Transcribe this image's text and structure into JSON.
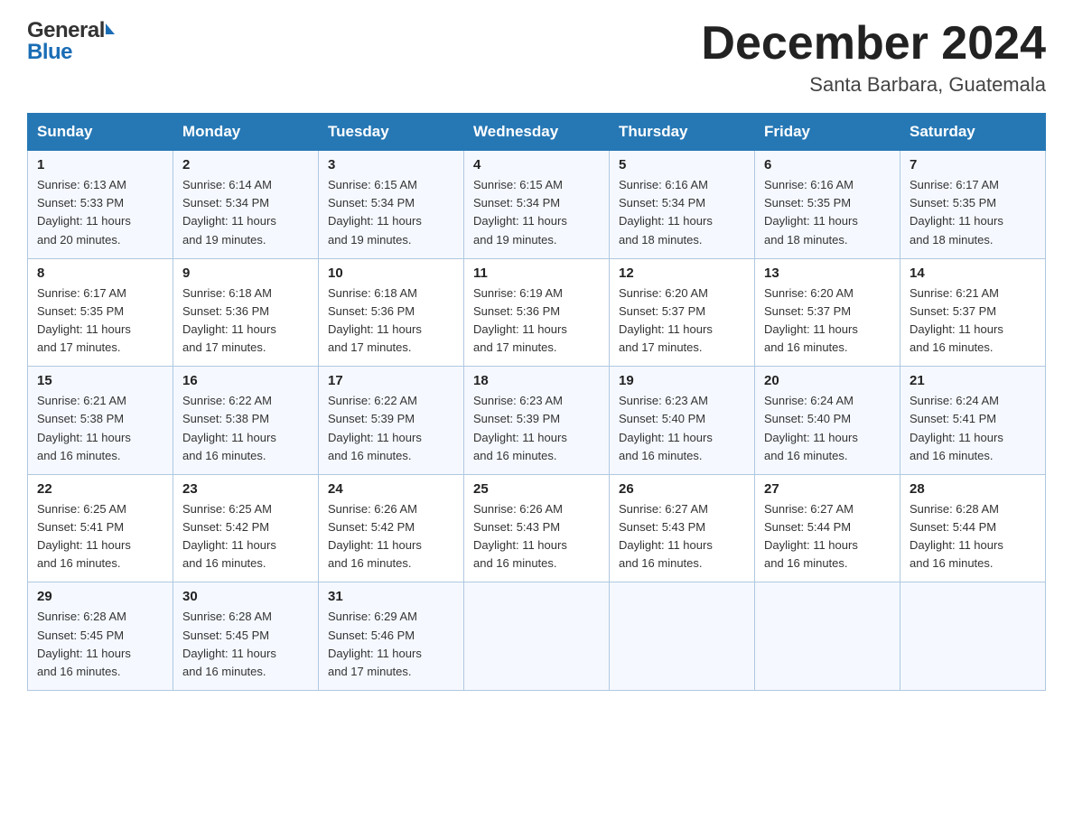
{
  "header": {
    "logo_general": "General",
    "logo_blue": "Blue",
    "month_title": "December 2024",
    "location": "Santa Barbara, Guatemala"
  },
  "days_of_week": [
    "Sunday",
    "Monday",
    "Tuesday",
    "Wednesday",
    "Thursday",
    "Friday",
    "Saturday"
  ],
  "weeks": [
    [
      {
        "day": "1",
        "sunrise": "6:13 AM",
        "sunset": "5:33 PM",
        "daylight": "11 hours and 20 minutes."
      },
      {
        "day": "2",
        "sunrise": "6:14 AM",
        "sunset": "5:34 PM",
        "daylight": "11 hours and 19 minutes."
      },
      {
        "day": "3",
        "sunrise": "6:15 AM",
        "sunset": "5:34 PM",
        "daylight": "11 hours and 19 minutes."
      },
      {
        "day": "4",
        "sunrise": "6:15 AM",
        "sunset": "5:34 PM",
        "daylight": "11 hours and 19 minutes."
      },
      {
        "day": "5",
        "sunrise": "6:16 AM",
        "sunset": "5:34 PM",
        "daylight": "11 hours and 18 minutes."
      },
      {
        "day": "6",
        "sunrise": "6:16 AM",
        "sunset": "5:35 PM",
        "daylight": "11 hours and 18 minutes."
      },
      {
        "day": "7",
        "sunrise": "6:17 AM",
        "sunset": "5:35 PM",
        "daylight": "11 hours and 18 minutes."
      }
    ],
    [
      {
        "day": "8",
        "sunrise": "6:17 AM",
        "sunset": "5:35 PM",
        "daylight": "11 hours and 17 minutes."
      },
      {
        "day": "9",
        "sunrise": "6:18 AM",
        "sunset": "5:36 PM",
        "daylight": "11 hours and 17 minutes."
      },
      {
        "day": "10",
        "sunrise": "6:18 AM",
        "sunset": "5:36 PM",
        "daylight": "11 hours and 17 minutes."
      },
      {
        "day": "11",
        "sunrise": "6:19 AM",
        "sunset": "5:36 PM",
        "daylight": "11 hours and 17 minutes."
      },
      {
        "day": "12",
        "sunrise": "6:20 AM",
        "sunset": "5:37 PM",
        "daylight": "11 hours and 17 minutes."
      },
      {
        "day": "13",
        "sunrise": "6:20 AM",
        "sunset": "5:37 PM",
        "daylight": "11 hours and 16 minutes."
      },
      {
        "day": "14",
        "sunrise": "6:21 AM",
        "sunset": "5:37 PM",
        "daylight": "11 hours and 16 minutes."
      }
    ],
    [
      {
        "day": "15",
        "sunrise": "6:21 AM",
        "sunset": "5:38 PM",
        "daylight": "11 hours and 16 minutes."
      },
      {
        "day": "16",
        "sunrise": "6:22 AM",
        "sunset": "5:38 PM",
        "daylight": "11 hours and 16 minutes."
      },
      {
        "day": "17",
        "sunrise": "6:22 AM",
        "sunset": "5:39 PM",
        "daylight": "11 hours and 16 minutes."
      },
      {
        "day": "18",
        "sunrise": "6:23 AM",
        "sunset": "5:39 PM",
        "daylight": "11 hours and 16 minutes."
      },
      {
        "day": "19",
        "sunrise": "6:23 AM",
        "sunset": "5:40 PM",
        "daylight": "11 hours and 16 minutes."
      },
      {
        "day": "20",
        "sunrise": "6:24 AM",
        "sunset": "5:40 PM",
        "daylight": "11 hours and 16 minutes."
      },
      {
        "day": "21",
        "sunrise": "6:24 AM",
        "sunset": "5:41 PM",
        "daylight": "11 hours and 16 minutes."
      }
    ],
    [
      {
        "day": "22",
        "sunrise": "6:25 AM",
        "sunset": "5:41 PM",
        "daylight": "11 hours and 16 minutes."
      },
      {
        "day": "23",
        "sunrise": "6:25 AM",
        "sunset": "5:42 PM",
        "daylight": "11 hours and 16 minutes."
      },
      {
        "day": "24",
        "sunrise": "6:26 AM",
        "sunset": "5:42 PM",
        "daylight": "11 hours and 16 minutes."
      },
      {
        "day": "25",
        "sunrise": "6:26 AM",
        "sunset": "5:43 PM",
        "daylight": "11 hours and 16 minutes."
      },
      {
        "day": "26",
        "sunrise": "6:27 AM",
        "sunset": "5:43 PM",
        "daylight": "11 hours and 16 minutes."
      },
      {
        "day": "27",
        "sunrise": "6:27 AM",
        "sunset": "5:44 PM",
        "daylight": "11 hours and 16 minutes."
      },
      {
        "day": "28",
        "sunrise": "6:28 AM",
        "sunset": "5:44 PM",
        "daylight": "11 hours and 16 minutes."
      }
    ],
    [
      {
        "day": "29",
        "sunrise": "6:28 AM",
        "sunset": "5:45 PM",
        "daylight": "11 hours and 16 minutes."
      },
      {
        "day": "30",
        "sunrise": "6:28 AM",
        "sunset": "5:45 PM",
        "daylight": "11 hours and 16 minutes."
      },
      {
        "day": "31",
        "sunrise": "6:29 AM",
        "sunset": "5:46 PM",
        "daylight": "11 hours and 17 minutes."
      },
      null,
      null,
      null,
      null
    ]
  ],
  "labels": {
    "sunrise": "Sunrise:",
    "sunset": "Sunset:",
    "daylight": "Daylight:"
  }
}
